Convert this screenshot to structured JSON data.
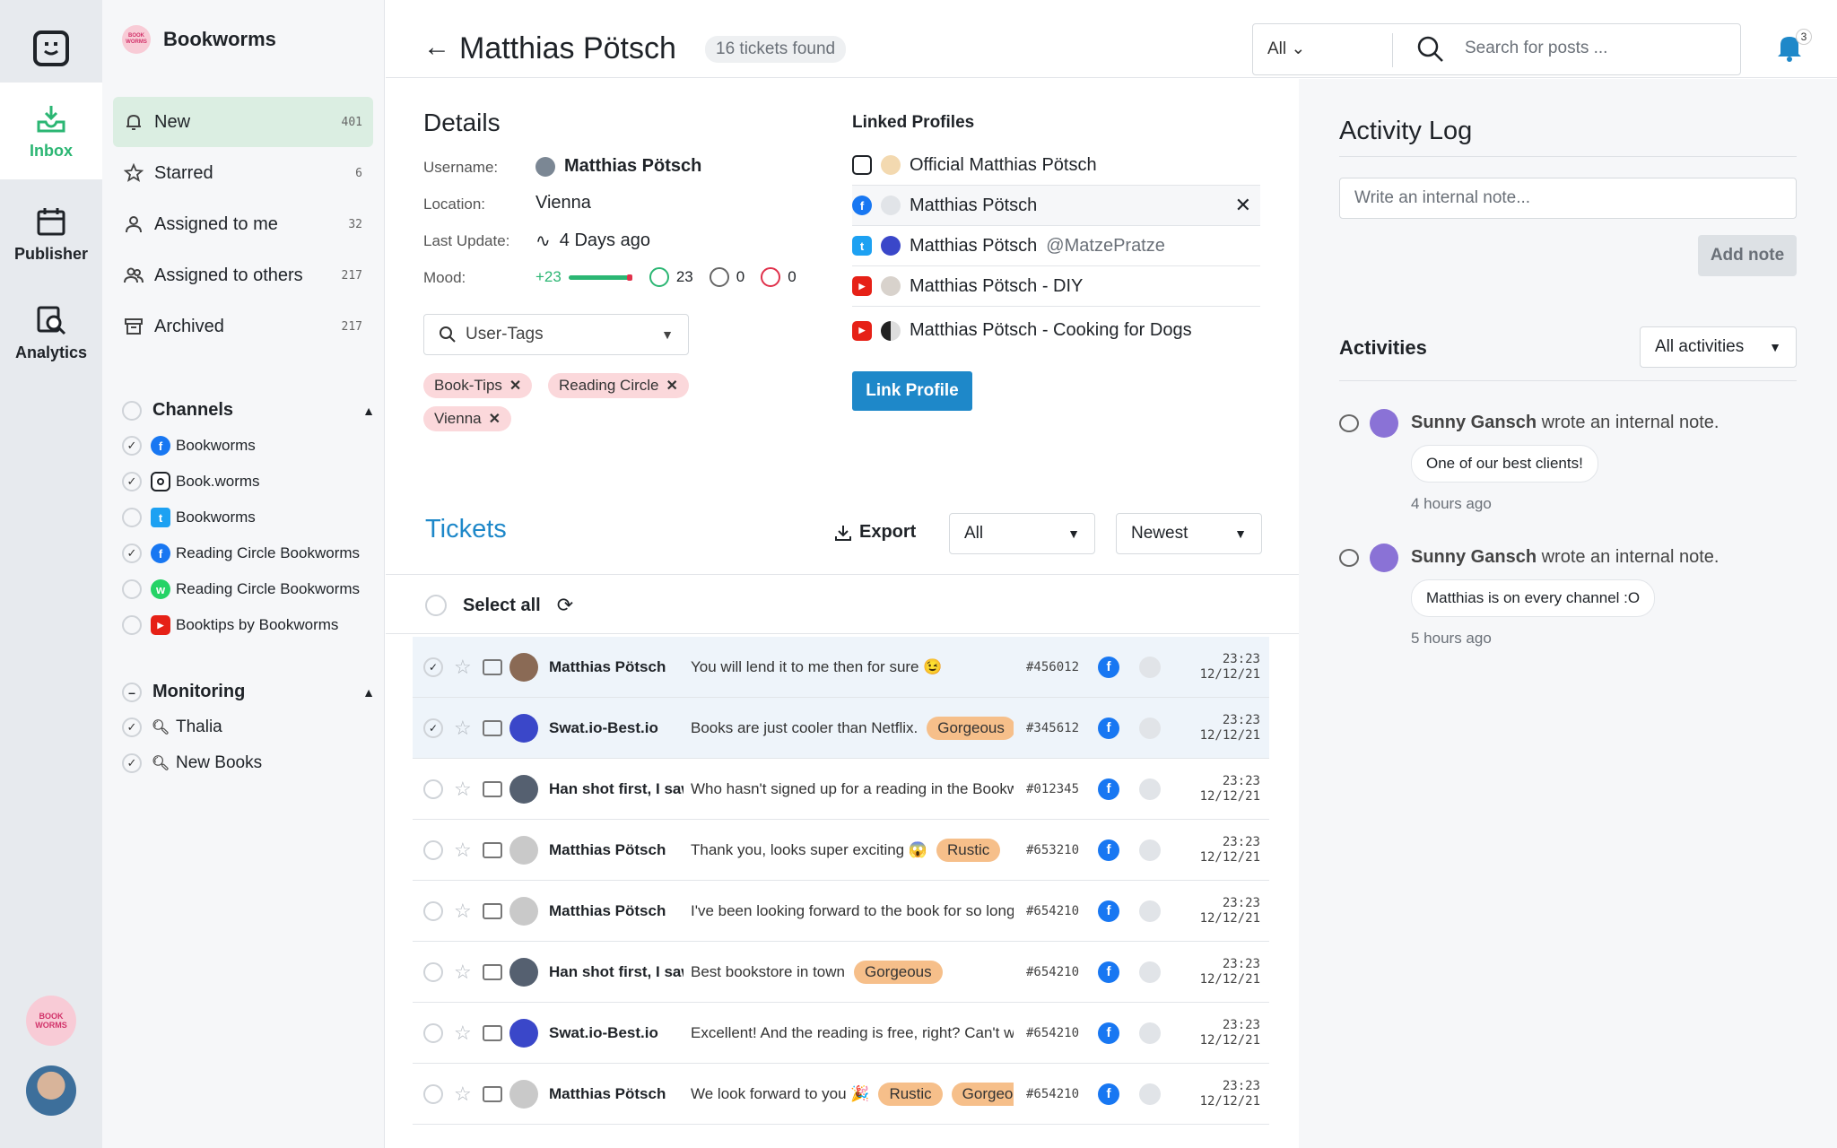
{
  "colors": {
    "accent_green": "#2bb673",
    "accent_blue": "#1e88c9",
    "chip_pink": "#fbd8db",
    "badge_orange": "#f6bf8a"
  },
  "rail": {
    "items": [
      {
        "label": "Inbox",
        "icon": "inbox-icon"
      },
      {
        "label": "Publisher",
        "icon": "calendar-icon"
      },
      {
        "label": "Analytics",
        "icon": "analytics-icon"
      }
    ],
    "brand_avatar_text": "BOOK WORMS"
  },
  "sidebar": {
    "brand": "Bookworms",
    "brand_badge": "BOOK WORMS",
    "nav": [
      {
        "label": "New",
        "count": "401",
        "icon": "bell-icon"
      },
      {
        "label": "Starred",
        "count": "6",
        "icon": "star-icon"
      },
      {
        "label": "Assigned to me",
        "count": "32",
        "icon": "user-icon"
      },
      {
        "label": "Assigned to others",
        "count": "217",
        "icon": "users-icon"
      },
      {
        "label": "Archived",
        "count": "217",
        "icon": "archive-icon"
      }
    ],
    "channels_title": "Channels",
    "channels": [
      {
        "label": "Bookworms",
        "network": "facebook",
        "checked": true
      },
      {
        "label": "Book.worms",
        "network": "instagram",
        "checked": true
      },
      {
        "label": "Bookworms",
        "network": "twitter",
        "checked": false
      },
      {
        "label": "Reading Circle Bookworms",
        "network": "facebook",
        "checked": true
      },
      {
        "label": "Reading Circle Bookworms",
        "network": "whatsapp",
        "checked": false
      },
      {
        "label": "Booktips by Bookworms",
        "network": "youtube",
        "checked": false
      }
    ],
    "monitoring_title": "Monitoring",
    "monitoring": [
      {
        "label": "Thalia",
        "checked": true
      },
      {
        "label": "New Books",
        "checked": true
      }
    ]
  },
  "header": {
    "title": "Matthias Pötsch",
    "found": "16 tickets found",
    "filter": "All",
    "search_placeholder": "Search for posts ...",
    "notif_count": "3"
  },
  "details": {
    "title": "Details",
    "username_label": "Username:",
    "username": "Matthias Pötsch",
    "location_label": "Location:",
    "location": "Vienna",
    "last_update_label": "Last Update:",
    "last_update": "4 Days ago",
    "mood_label": "Mood:",
    "mood_score": "+23",
    "mood_positive": "23",
    "mood_neutral": "0",
    "mood_negative": "0",
    "tags_placeholder": "User-Tags",
    "tags": [
      "Book-Tips",
      "Reading Circle",
      "Vienna"
    ]
  },
  "linked": {
    "title": "Linked Profiles",
    "profiles": [
      {
        "name": "Official Matthias Pötsch",
        "handle": "",
        "network": "instagram"
      },
      {
        "name": "Matthias Pötsch",
        "handle": "",
        "network": "facebook"
      },
      {
        "name": "Matthias Pötsch",
        "handle": "@MatzePratze",
        "network": "twitter"
      },
      {
        "name": "Matthias Pötsch - DIY",
        "handle": "",
        "network": "youtube"
      },
      {
        "name": "Matthias Pötsch - Cooking for Dogs",
        "handle": "",
        "network": "youtube"
      }
    ],
    "link_button": "Link Profile"
  },
  "tickets": {
    "title": "Tickets",
    "export": "Export",
    "filter": "All",
    "sort": "Newest",
    "select_all": "Select all",
    "rows": [
      {
        "name": "Matthias Pötsch",
        "msg": "You will lend it to me then for sure 😉",
        "badges": [],
        "id": "#456012",
        "time": "23:23",
        "date": "12/12/21",
        "checked": true,
        "avatar": "#8a6a55"
      },
      {
        "name": "Swat.io-Best.io",
        "msg": "Books are just cooler than Netflix.",
        "badges": [
          "Gorgeous"
        ],
        "id": "#345612",
        "time": "23:23",
        "date": "12/12/21",
        "checked": true,
        "avatar": "#3a47c9"
      },
      {
        "name": "Han shot first, I saw it",
        "msg": "Who hasn't signed up for a reading in the Bookworms",
        "badges": [],
        "id": "#012345",
        "time": "23:23",
        "date": "12/12/21",
        "checked": false,
        "avatar": "#556070"
      },
      {
        "name": "Matthias Pötsch",
        "msg": "Thank you, looks super exciting 😱",
        "badges": [
          "Rustic"
        ],
        "id": "#653210",
        "time": "23:23",
        "date": "12/12/21",
        "checked": false,
        "avatar": "#c9c9c9"
      },
      {
        "name": "Matthias Pötsch",
        "msg": "I've been looking forward to the book for so long",
        "badges": [],
        "id": "#654210",
        "time": "23:23",
        "date": "12/12/21",
        "checked": false,
        "avatar": "#c9c9c9"
      },
      {
        "name": "Han shot first, I saw it",
        "msg": "Best bookstore in town",
        "badges": [
          "Gorgeous"
        ],
        "id": "#654210",
        "time": "23:23",
        "date": "12/12/21",
        "checked": false,
        "avatar": "#556070"
      },
      {
        "name": "Swat.io-Best.io",
        "msg": "Excellent! And the reading is free, right? Can't wait",
        "badges": [],
        "id": "#654210",
        "time": "23:23",
        "date": "12/12/21",
        "checked": false,
        "avatar": "#3a47c9"
      },
      {
        "name": "Matthias Pötsch",
        "msg": "We look forward to you 🎉",
        "badges": [
          "Rustic",
          "Gorgeous"
        ],
        "id": "#654210",
        "time": "23:23",
        "date": "12/12/21",
        "checked": false,
        "avatar": "#c9c9c9"
      }
    ]
  },
  "activity": {
    "title": "Activity Log",
    "note_placeholder": "Write an internal note...",
    "add_note": "Add note",
    "activities_title": "Activities",
    "filter": "All activities",
    "items": [
      {
        "author": "Sunny Gansch",
        "action": " wrote an internal note.",
        "note": "One of our best clients!",
        "ago": "4 hours ago"
      },
      {
        "author": "Sunny Gansch",
        "action": " wrote an internal note.",
        "note": "Matthias is on every channel :O",
        "ago": "5 hours ago"
      }
    ]
  }
}
